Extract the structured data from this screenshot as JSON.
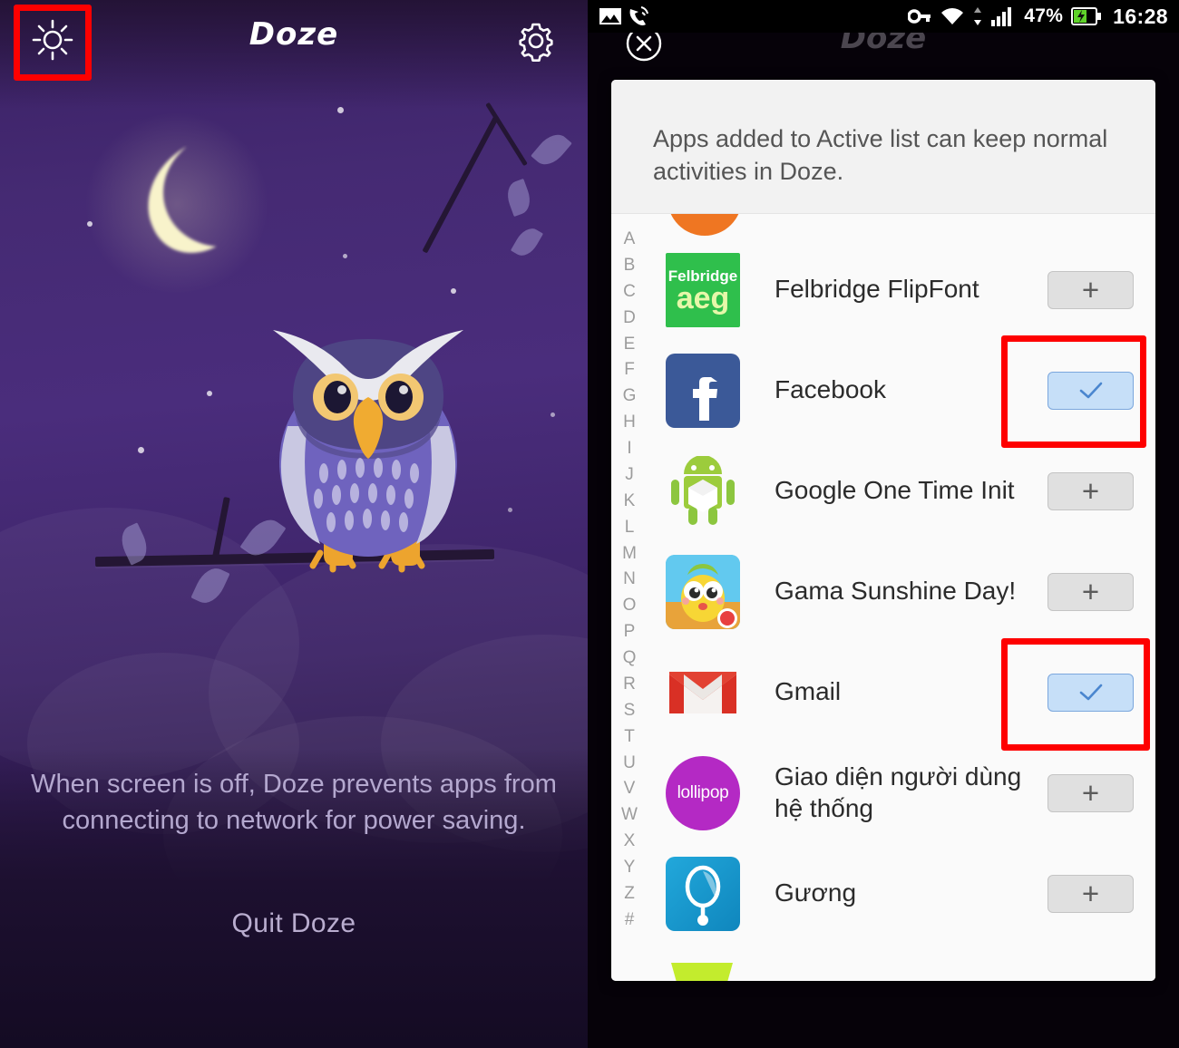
{
  "left_panel": {
    "app_title": "Doze",
    "brightness_icon": "sun-icon",
    "settings_icon": "gear-icon",
    "illustration": "owl-on-branch-night-scene",
    "caption": "When screen is off, Doze prevents apps from connecting to network for power saving.",
    "quit_label": "Quit Doze",
    "colors": {
      "background_top": "#3a2064",
      "background_mid": "#4a2d7c",
      "background_bottom": "#140b23",
      "moon": "#f7f2c8",
      "owl_body": "#6f63b8",
      "owl_head": "#4e4584",
      "owl_beak": "#f2a73b",
      "highlight_box": "#fe0000"
    }
  },
  "right_panel": {
    "statusbar": {
      "left_icons": [
        "image-icon",
        "missed-call-icon"
      ],
      "right_icons": [
        "vpn-key-icon",
        "wifi-icon",
        "signal-bars-icon",
        "battery-charging-icon"
      ],
      "battery_percent": "47%",
      "time": "16:28"
    },
    "close_icon": "close-circle-icon",
    "background_title": "Doze",
    "dialog": {
      "header_text": "Apps added to Active list can keep normal activities in Doze.",
      "alphabet_index": [
        "A",
        "B",
        "C",
        "D",
        "E",
        "F",
        "G",
        "H",
        "I",
        "J",
        "K",
        "L",
        "M",
        "N",
        "O",
        "P",
        "Q",
        "R",
        "S",
        "T",
        "U",
        "V",
        "W",
        "X",
        "Y",
        "Z",
        "#"
      ],
      "apps": [
        {
          "name": "Felbridge FlipFont",
          "icon": "felbridge-flipfont-icon",
          "icon_text_top": "Felbridge",
          "icon_text_bottom": "aeg",
          "icon_color": "#2fbf4c",
          "state": "add",
          "button_label": "+",
          "highlighted": false
        },
        {
          "name": "Facebook",
          "icon": "facebook-icon",
          "icon_text_top": "f",
          "icon_color": "#3b5998",
          "state": "active",
          "button_label": "✓",
          "highlighted": true
        },
        {
          "name": "Google One Time Init",
          "icon": "android-robot-icon",
          "icon_color": "#a4c639",
          "state": "add",
          "button_label": "+",
          "highlighted": false
        },
        {
          "name": "Gama Sunshine Day!",
          "icon": "gama-sunshine-day-icon",
          "icon_color": "#4fc3e8",
          "state": "add",
          "button_label": "+",
          "highlighted": false
        },
        {
          "name": "Gmail",
          "icon": "gmail-icon",
          "icon_color": "#d93025",
          "state": "active",
          "button_label": "✓",
          "highlighted": true
        },
        {
          "name": "Giao diện người dùng hệ thống",
          "icon": "lollipop-icon",
          "icon_text_top": "lollipop",
          "icon_color": "#b429c4",
          "state": "add",
          "button_label": "+",
          "highlighted": false
        },
        {
          "name": "Gương",
          "icon": "mirror-icon",
          "icon_color": "#129bd2",
          "state": "add",
          "button_label": "+",
          "highlighted": false
        }
      ],
      "partial_top_icon": "orange-app-icon-cutoff",
      "partial_bottom_icon": "lime-app-icon-cutoff"
    }
  }
}
